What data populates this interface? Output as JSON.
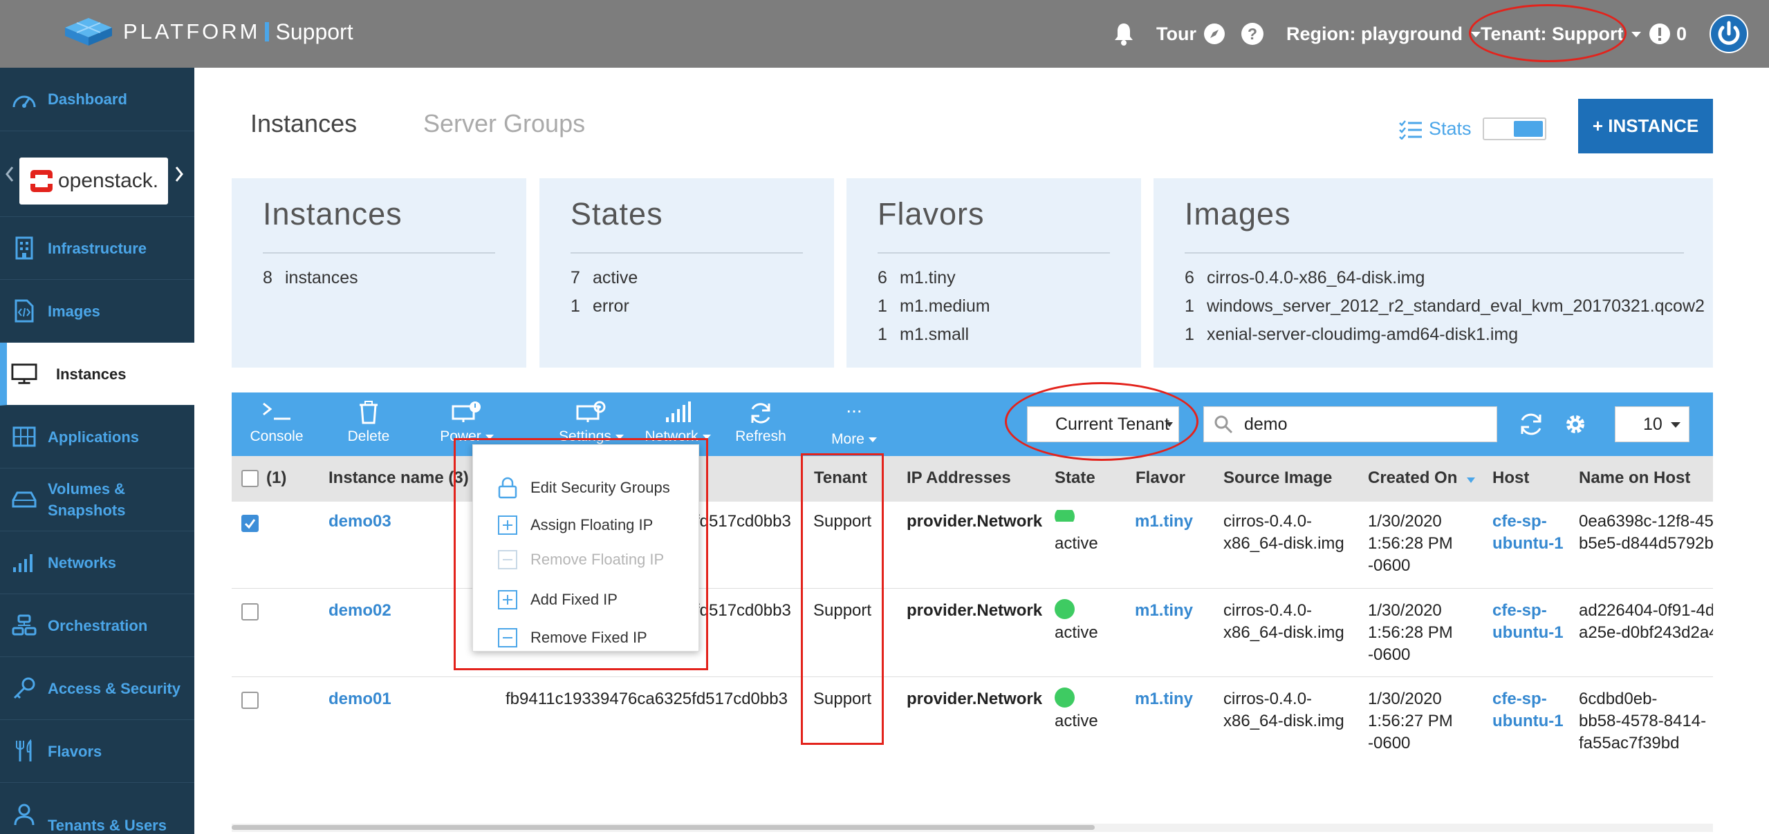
{
  "header": {
    "brand": "PLATFORM",
    "product": "Support",
    "tour_label": "Tour",
    "region_label": "Region: playground",
    "tenant_label": "Tenant: Support",
    "alerts_count": "0"
  },
  "sidebar": {
    "cloud_logo_text": "openstack.",
    "items": [
      {
        "label": "Dashboard",
        "icon": "gauge-icon"
      },
      {
        "label": "Infrastructure",
        "icon": "building-icon"
      },
      {
        "label": "Images",
        "icon": "file-code-icon"
      },
      {
        "label": "Instances",
        "icon": "monitor-icon"
      },
      {
        "label": "Applications",
        "icon": "grid-icon"
      },
      {
        "label": "Volumes & Snapshots",
        "icon": "drive-icon"
      },
      {
        "label": "Networks",
        "icon": "signal-bars-icon"
      },
      {
        "label": "Orchestration",
        "icon": "stack-icon"
      },
      {
        "label": "Access & Security",
        "icon": "key-icon"
      },
      {
        "label": "Flavors",
        "icon": "utensils-icon"
      },
      {
        "label": "Tenants & Users",
        "icon": "user-icon"
      }
    ]
  },
  "tabs": {
    "instances": "Instances",
    "server_groups": "Server Groups"
  },
  "stats_label": "Stats",
  "add_instance_label": "+ INSTANCE",
  "cards": {
    "instances": {
      "title": "Instances",
      "rows": [
        {
          "count": "8",
          "label": "instances"
        }
      ]
    },
    "states": {
      "title": "States",
      "rows": [
        {
          "count": "7",
          "label": "active"
        },
        {
          "count": "1",
          "label": "error"
        }
      ]
    },
    "flavors": {
      "title": "Flavors",
      "rows": [
        {
          "count": "6",
          "label": "m1.tiny"
        },
        {
          "count": "1",
          "label": "m1.medium"
        },
        {
          "count": "1",
          "label": "m1.small"
        }
      ]
    },
    "images": {
      "title": "Images",
      "rows": [
        {
          "count": "6",
          "label": "cirros-0.4.0-x86_64-disk.img"
        },
        {
          "count": "1",
          "label": "windows_server_2012_r2_standard_eval_kvm_20170321.qcow2"
        },
        {
          "count": "1",
          "label": "xenial-server-cloudimg-amd64-disk1.img"
        }
      ]
    }
  },
  "toolbar": {
    "console": "Console",
    "delete": "Delete",
    "power": "Power",
    "settings": "Settings",
    "network": "Network",
    "refresh": "Refresh",
    "more": "More",
    "more_dots": "...",
    "scope_select": "Current Tenant",
    "search_value": "demo",
    "page_size": "10"
  },
  "table": {
    "headers": {
      "selected": "(1)",
      "name": "Instance name (3)",
      "tenant": "Tenant",
      "ip": "IP Addresses",
      "state": "State",
      "flavor": "Flavor",
      "image": "Source Image",
      "created": "Created On",
      "host": "Host",
      "name_on_host": "Name on Host"
    },
    "rows": [
      {
        "name": "demo03",
        "id": "fd517cd0bb3",
        "tenant": "Support",
        "ip": "provider.Network",
        "state": "active",
        "flavor": "m1.tiny",
        "image_1": "cirros-0.4.0-",
        "image_2": "x86_64-disk.img",
        "created_1": "1/30/2020",
        "created_2": "1:56:28 PM",
        "created_3": "-0600",
        "host_1": "cfe-sp-",
        "host_2": "ubuntu-1",
        "noh_1": "0ea6398c-12f8-45",
        "noh_2": "b5e5-d844d5792b",
        "noh_3": "",
        "checked": true
      },
      {
        "name": "demo02",
        "id": "fd517cd0bb3",
        "tenant": "Support",
        "ip": "provider.Network",
        "state": "active",
        "flavor": "m1.tiny",
        "image_1": "cirros-0.4.0-",
        "image_2": "x86_64-disk.img",
        "created_1": "1/30/2020",
        "created_2": "1:56:28 PM",
        "created_3": "-0600",
        "host_1": "cfe-sp-",
        "host_2": "ubuntu-1",
        "noh_1": "ad226404-0f91-4d",
        "noh_2": "a25e-d0bf243d2a4",
        "noh_3": "",
        "checked": false
      },
      {
        "name": "demo01",
        "id": "fb9411c19339476ca6325fd517cd0bb3",
        "tenant": "Support",
        "ip": "provider.Network",
        "state": "active",
        "flavor": "m1.tiny",
        "image_1": "cirros-0.4.0-",
        "image_2": "x86_64-disk.img",
        "created_1": "1/30/2020",
        "created_2": "1:56:27 PM",
        "created_3": "-0600",
        "host_1": "cfe-sp-",
        "host_2": "ubuntu-1",
        "noh_1": "6cdbd0eb-",
        "noh_2": "bb58-4578-8414-",
        "noh_3": "fa55ac7f39bd",
        "checked": false
      }
    ]
  },
  "network_menu": {
    "items": [
      {
        "label": "Edit Security Groups",
        "icon": "lock-icon",
        "disabled": false
      },
      {
        "label": "Assign Floating IP",
        "icon": "plus-box-icon",
        "disabled": false
      },
      {
        "label": "Remove Floating IP",
        "icon": "minus-box-icon",
        "disabled": true
      },
      {
        "label": "Add Fixed IP",
        "icon": "plus-box-icon",
        "disabled": false
      },
      {
        "label": "Remove Fixed IP",
        "icon": "minus-box-icon",
        "disabled": false
      }
    ]
  },
  "colors": {
    "accent": "#4ba6e9",
    "sidebar_bg": "#1d3a4f",
    "topbar_bg": "#7d7d7d",
    "highlight": "#e3231c",
    "active_state": "#3ecb62"
  }
}
